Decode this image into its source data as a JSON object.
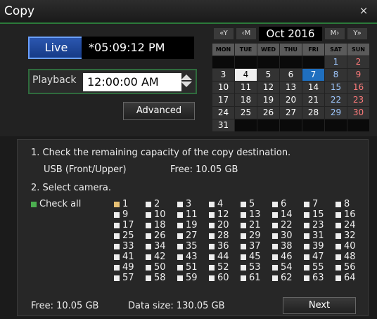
{
  "window": {
    "title": "Copy",
    "close_icon": "×"
  },
  "top": {
    "live_label": "Live",
    "live_time": "*05:09:12 PM",
    "playback_label": "Playback",
    "playback_time": "12:00:00 AM",
    "advanced_label": "Advanced"
  },
  "calendar": {
    "nav": {
      "prev_year": "«Y",
      "prev_month": "‹M",
      "month": "Oct 2016",
      "next_month": "M›",
      "next_year": "Y»"
    },
    "weekdays": [
      "MON",
      "TUE",
      "WED",
      "THU",
      "FRI",
      "SAT",
      "SUN"
    ],
    "weeks": [
      [
        "",
        "",
        "",
        "",
        "",
        "1",
        "2"
      ],
      [
        "3",
        "4",
        "5",
        "6",
        "7",
        "8",
        "9"
      ],
      [
        "10",
        "11",
        "12",
        "13",
        "14",
        "15",
        "16"
      ],
      [
        "17",
        "18",
        "19",
        "20",
        "21",
        "22",
        "23"
      ],
      [
        "24",
        "25",
        "26",
        "27",
        "28",
        "29",
        "30"
      ],
      [
        "31",
        "",
        "",
        "",
        "",
        "",
        ""
      ]
    ],
    "selected_day": "7",
    "highlighted_day": "4"
  },
  "copy": {
    "step1": "1. Check the remaining capacity of the copy destination.",
    "destination": "USB (Front/Upper)",
    "free_label": "Free: 10.05 GB",
    "step2": "2. Select camera.",
    "check_all_label": "Check all",
    "cameras": [
      [
        "1",
        "2",
        "3",
        "4",
        "5",
        "6",
        "7",
        "8"
      ],
      [
        "9",
        "10",
        "11",
        "12",
        "13",
        "14",
        "15",
        "16"
      ],
      [
        "17",
        "18",
        "19",
        "20",
        "21",
        "22",
        "23",
        "24"
      ],
      [
        "25",
        "26",
        "27",
        "28",
        "29",
        "30",
        "31",
        "32"
      ],
      [
        "33",
        "34",
        "35",
        "36",
        "37",
        "38",
        "39",
        "40"
      ],
      [
        "41",
        "42",
        "43",
        "44",
        "45",
        "46",
        "47",
        "48"
      ],
      [
        "49",
        "50",
        "51",
        "52",
        "53",
        "54",
        "55",
        "56"
      ],
      [
        "57",
        "58",
        "59",
        "60",
        "61",
        "62",
        "63",
        "64"
      ]
    ],
    "checked_camera": "1",
    "footer_free": "Free: 10.05 GB",
    "data_size": "Data size: 130.05 GB",
    "next_label": "Next"
  },
  "colors": {
    "accent_green": "#2c7a3a",
    "live_blue": "#163b86",
    "selected_day": "#1f6fbf",
    "checked_box": "#e6c074"
  }
}
